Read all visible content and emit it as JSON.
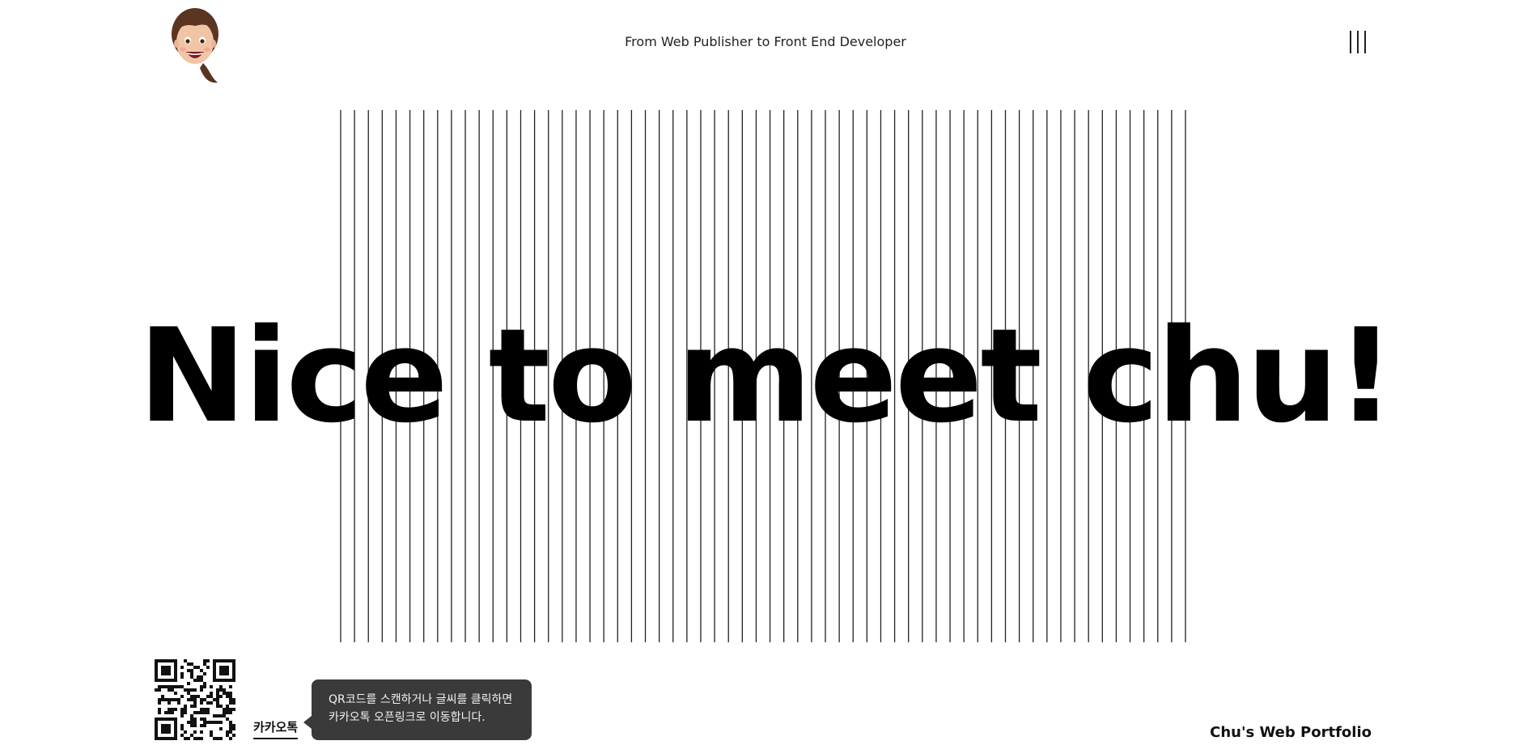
{
  "header": {
    "tagline": "From Web Publisher to Front End Developer",
    "avatar_icon": "memoji-avatar-icon",
    "menu_icon": "menu-lines-icon"
  },
  "hero": {
    "title": "Nice to meet chu!",
    "stripe_count": 62
  },
  "footer": {
    "qr_icon": "qr-code-icon",
    "kakao_label": "카카오톡",
    "tooltip_line1": "QR코드를 스캔하거나 글씨를 클릭하면",
    "tooltip_line2": "카카오톡 오픈링크로 이동합니다.",
    "brand": "Chu's Web Portfolio"
  },
  "colors": {
    "text": "#111111",
    "tooltip_bg": "#3a3a3a",
    "background": "#ffffff"
  }
}
